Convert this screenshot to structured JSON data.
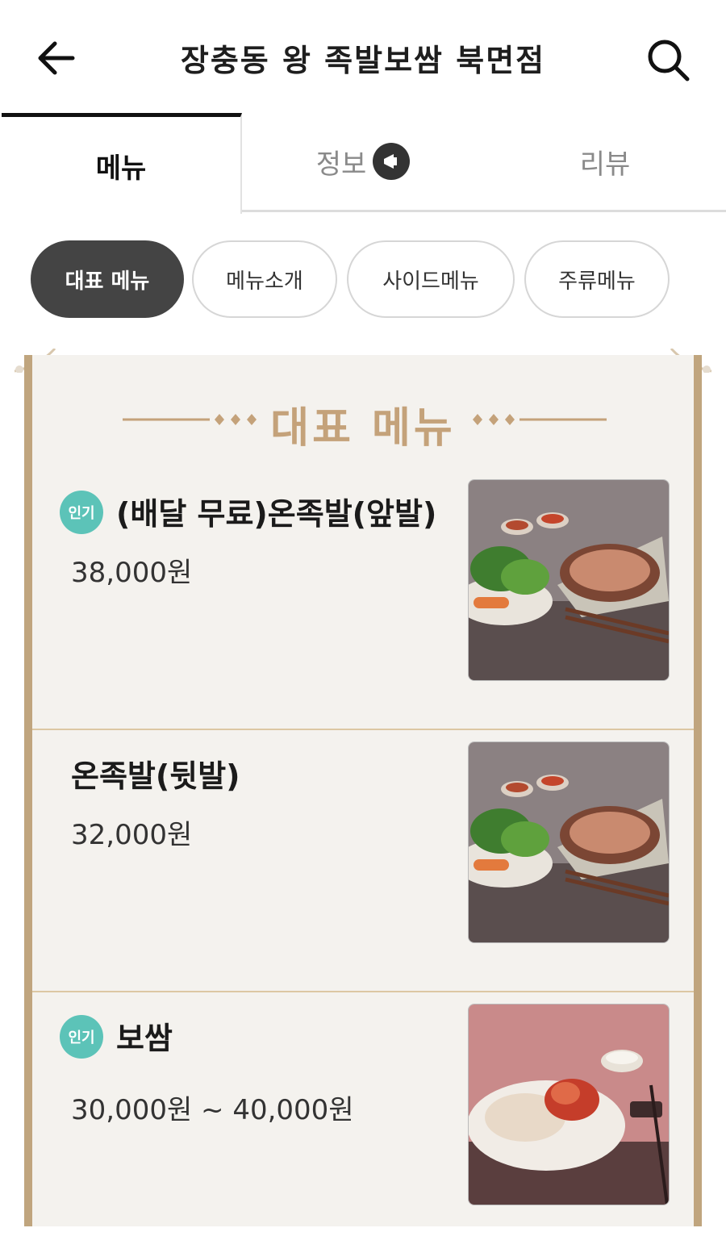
{
  "header": {
    "title": "장충동 왕 족발보쌈 북면점"
  },
  "tabs": [
    {
      "label": "메뉴"
    },
    {
      "label": "정보"
    },
    {
      "label": "리뷰"
    }
  ],
  "categories": [
    {
      "label": "대표 메뉴"
    },
    {
      "label": "메뉴소개"
    },
    {
      "label": "사이드메뉴"
    },
    {
      "label": "주류메뉴"
    }
  ],
  "section": {
    "title": "대표 메뉴"
  },
  "items": [
    {
      "badge": "인기",
      "name": "(배달 무료)온족발(앞발)",
      "price": "38,000원"
    },
    {
      "badge": "",
      "name": "온족발(뒷발)",
      "price": "32,000원"
    },
    {
      "badge": "인기",
      "name": "보쌈",
      "price": "30,000원 ~ 40,000원"
    }
  ],
  "colors": {
    "accent": "#c4a27a",
    "badge": "#5cc3b8",
    "board": "#f4f2ee"
  }
}
